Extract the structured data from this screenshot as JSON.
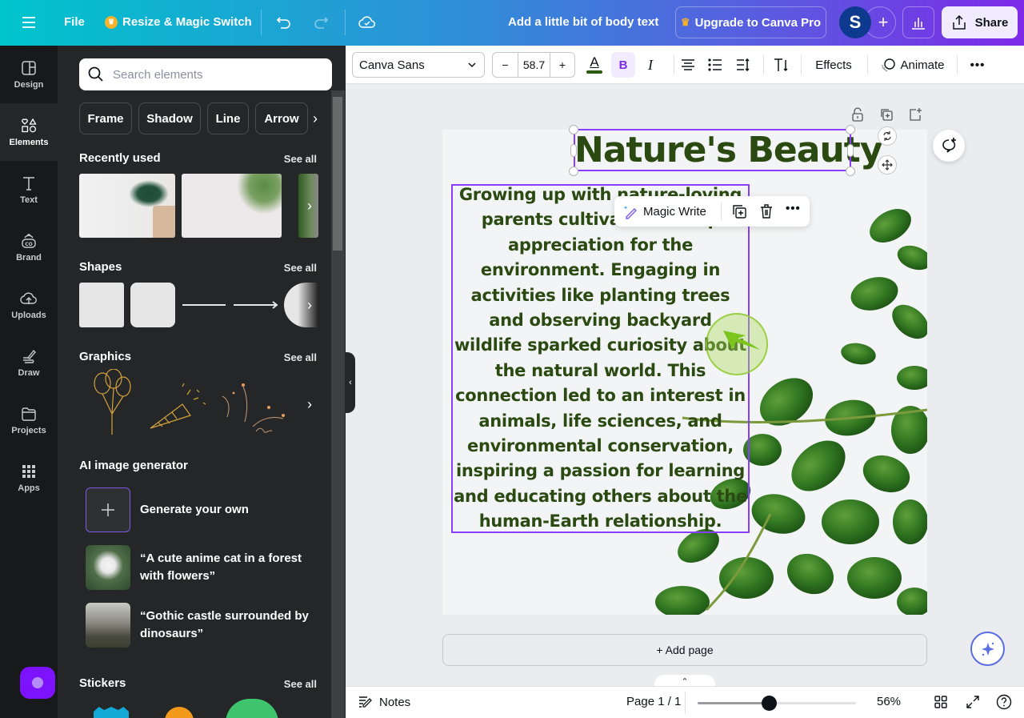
{
  "topbar": {
    "menu_icon": "hamburger-icon",
    "file_label": "File",
    "resize_label": "Resize & Magic Switch",
    "design_title": "Add a little bit of body text",
    "upgrade_label": "Upgrade to Canva Pro",
    "avatar_initial": "S",
    "add_icon": "+",
    "share_label": "Share"
  },
  "rail": {
    "items": [
      {
        "label": "Design",
        "icon": "layout-icon"
      },
      {
        "label": "Elements",
        "icon": "shapes-icon",
        "active": true
      },
      {
        "label": "Text",
        "icon": "text-icon"
      },
      {
        "label": "Brand",
        "icon": "brand-icon"
      },
      {
        "label": "Uploads",
        "icon": "cloud-upload-icon"
      },
      {
        "label": "Draw",
        "icon": "draw-icon"
      },
      {
        "label": "Projects",
        "icon": "folder-icon"
      },
      {
        "label": "Apps",
        "icon": "apps-grid-icon"
      }
    ]
  },
  "panel": {
    "search_placeholder": "Search elements",
    "chips": [
      "Frame",
      "Shadow",
      "Line",
      "Arrow"
    ],
    "recently_used": {
      "title": "Recently used",
      "see_all": "See all"
    },
    "shapes": {
      "title": "Shapes",
      "see_all": "See all"
    },
    "graphics": {
      "title": "Graphics",
      "see_all": "See all"
    },
    "ai_generator": {
      "title": "AI image generator",
      "items": [
        {
          "label": "Generate your own"
        },
        {
          "label": "“A cute anime cat in a forest with flowers”"
        },
        {
          "label": "“Gothic castle surrounded by dinosaurs”"
        }
      ]
    },
    "stickers": {
      "title": "Stickers",
      "see_all": "See all"
    }
  },
  "toolbar": {
    "font_family": "Canva Sans",
    "font_size": "58.7",
    "decrease": "−",
    "increase": "+",
    "text_color": "#2b5a12",
    "effects_label": "Effects",
    "animate_label": "Animate",
    "more": "•••"
  },
  "canvas": {
    "title": "Nature's Beauty",
    "body": "Growing up with nature-loving parents cultivated a deep appreciation for the environment. Engaging in activities like planting trees and observing backyard wildlife sparked curiosity about the natural world. This connection led to an interest in animals, life sciences, and environmental conservation, inspiring a passion for learning and educating others about the human-Earth relationship.",
    "text_color": "#2b4a12",
    "selection_color": "#8b3dff"
  },
  "float_bar": {
    "magic_write_label": "Magic Write"
  },
  "add_page_label": "+ Add page",
  "footer": {
    "notes_label": "Notes",
    "page_indicator": "Page 1 / 1",
    "zoom_percent": "56%",
    "zoom_value": 0.56
  }
}
